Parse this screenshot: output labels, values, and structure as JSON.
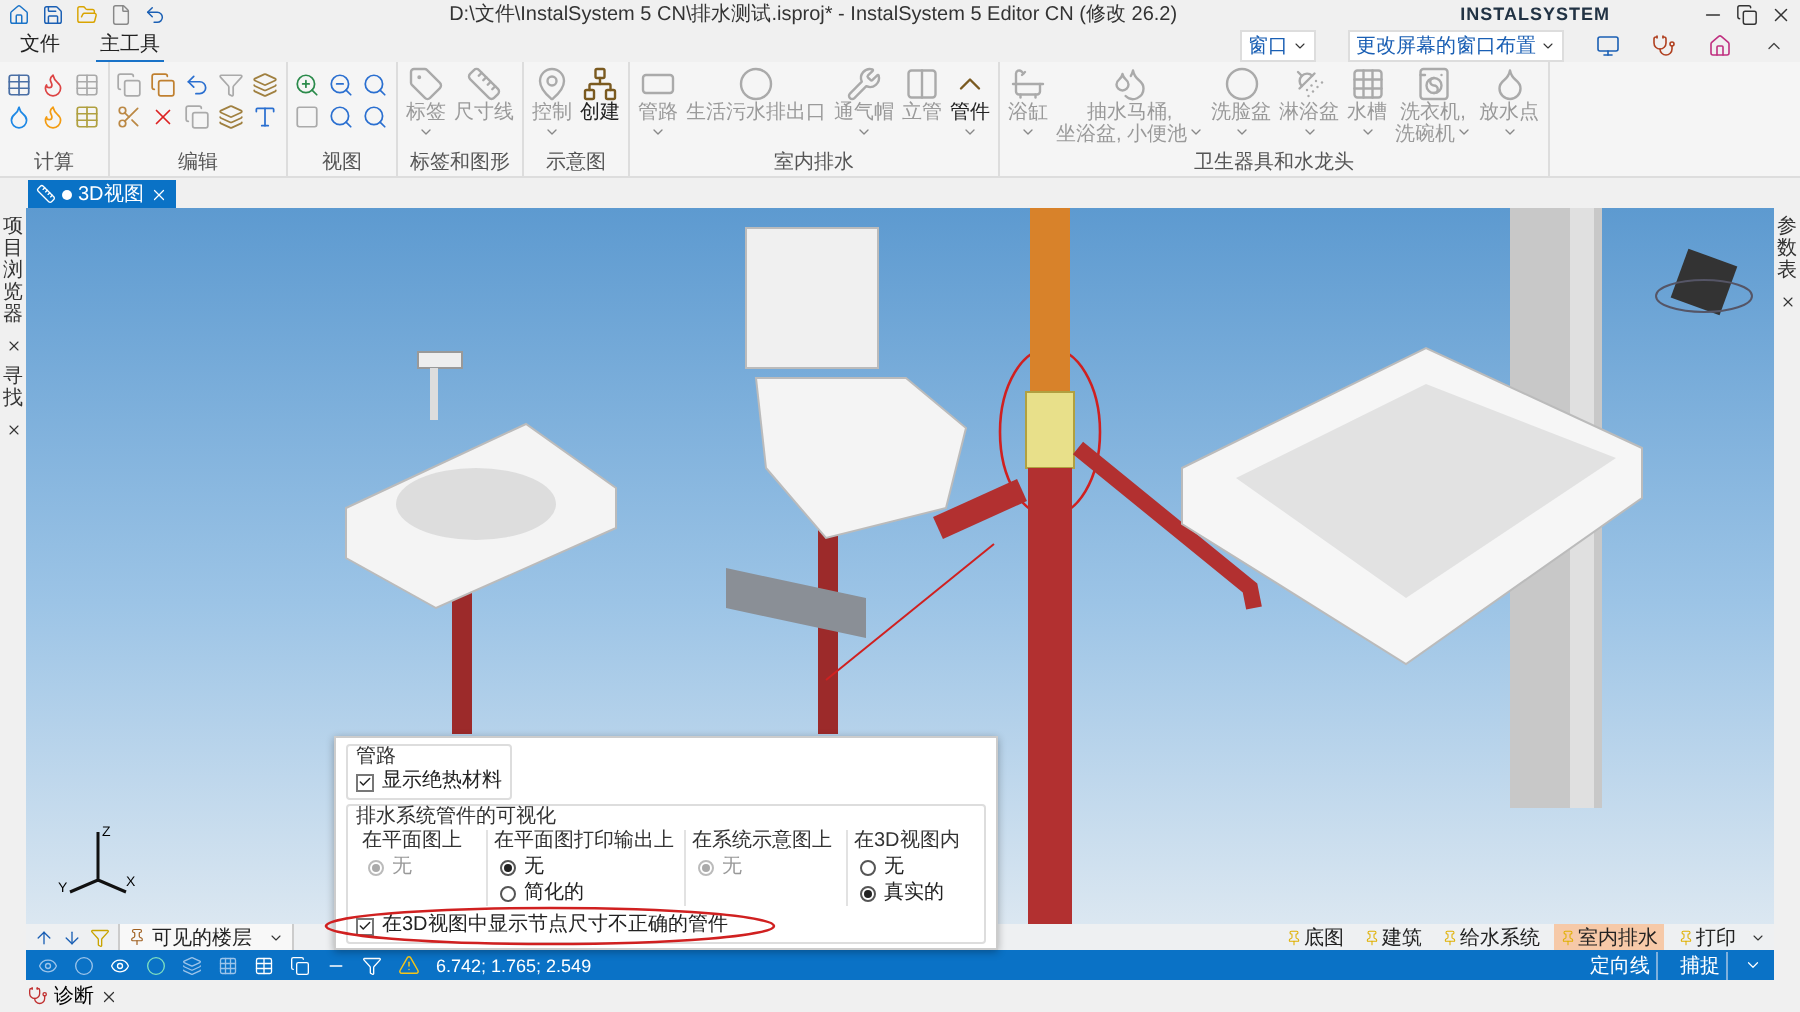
{
  "title_bar": {
    "title": "D:\\文件\\InstalSystem 5 CN\\排水测试.isproj* - InstalSystem 5 Editor CN (修改 26.2)",
    "logo": "INSTALSYSTEM"
  },
  "menu_tabs": [
    {
      "label": "文件",
      "selected": false
    },
    {
      "label": "主工具",
      "selected": true
    }
  ],
  "window_menus": [
    {
      "label": "窗口"
    },
    {
      "label": "更改屏幕的窗口布置"
    }
  ],
  "ribbon_groups": [
    {
      "label": "计算"
    },
    {
      "label": "编辑"
    },
    {
      "label": "视图"
    },
    {
      "label": "标签和图形",
      "buttons": [
        {
          "lines": [
            "标签"
          ],
          "disabled": true,
          "dropdown": true
        },
        {
          "lines": [
            "尺寸线"
          ],
          "disabled": true,
          "dropdown": false
        }
      ]
    },
    {
      "label": "示意图",
      "buttons": [
        {
          "lines": [
            "控制"
          ],
          "disabled": true,
          "dropdown": true
        },
        {
          "lines": [
            "创建"
          ],
          "disabled": false,
          "dropdown": false
        }
      ]
    },
    {
      "label": "室内排水",
      "buttons": [
        {
          "lines": [
            "管路"
          ],
          "disabled": true,
          "dropdown": true
        },
        {
          "lines": [
            "生活污水排出口"
          ],
          "disabled": true,
          "dropdown": false
        },
        {
          "lines": [
            "通气帽"
          ],
          "disabled": true,
          "dropdown": true
        },
        {
          "lines": [
            "立管"
          ],
          "disabled": true,
          "dropdown": false
        },
        {
          "lines": [
            "管件"
          ],
          "disabled": false,
          "dropdown": true
        }
      ]
    },
    {
      "label": "卫生器具和水龙头",
      "buttons": [
        {
          "lines": [
            "浴缸"
          ],
          "disabled": true,
          "dropdown": true
        },
        {
          "lines": [
            "抽水马桶,",
            "坐浴盆, 小便池"
          ],
          "disabled": true,
          "dropdown": true
        },
        {
          "lines": [
            "洗脸盆"
          ],
          "disabled": true,
          "dropdown": true
        },
        {
          "lines": [
            "淋浴盆"
          ],
          "disabled": true,
          "dropdown": true
        },
        {
          "lines": [
            "水槽"
          ],
          "disabled": true,
          "dropdown": true
        },
        {
          "lines": [
            "洗衣机,",
            "洗碗机"
          ],
          "disabled": true,
          "dropdown": true
        },
        {
          "lines": [
            "放水点"
          ],
          "disabled": true,
          "dropdown": true
        }
      ]
    }
  ],
  "document_tab": {
    "label": "3D视图",
    "modified": true,
    "selected": true
  },
  "left_panels": [
    {
      "label": "项目浏览器"
    },
    {
      "label": "寻找"
    }
  ],
  "right_panels": [
    {
      "label": "参数表"
    }
  ],
  "axis_labels": [
    "Z",
    "Y",
    "X"
  ],
  "floor_select": {
    "value": "可见的楼层"
  },
  "layer_tags": [
    {
      "label": "底图",
      "selected": false
    },
    {
      "label": "建筑",
      "selected": false
    },
    {
      "label": "给水系统",
      "selected": false
    },
    {
      "label": "室内排水",
      "selected": true
    },
    {
      "label": "打印",
      "selected": false
    }
  ],
  "popup": {
    "pipes_group": {
      "title": "管路",
      "checkbox": {
        "label": "显示绝热材料",
        "checked": true
      }
    },
    "fittings_group": {
      "title": "排水系统管件的可视化",
      "columns": [
        {
          "heading": "在平面图上",
          "options": [
            {
              "label": "无",
              "selected": true,
              "disabled": true
            }
          ]
        },
        {
          "heading": "在平面图打印输出上",
          "options": [
            {
              "label": "无",
              "selected": true,
              "disabled": false
            },
            {
              "label": "简化的",
              "selected": false,
              "disabled": false
            }
          ]
        },
        {
          "heading": "在系统示意图上",
          "options": [
            {
              "label": "无",
              "selected": true,
              "disabled": true
            }
          ]
        },
        {
          "heading": "在3D视图内",
          "options": [
            {
              "label": "无",
              "selected": false,
              "disabled": false
            },
            {
              "label": "真实的",
              "selected": true,
              "disabled": false
            }
          ]
        }
      ]
    },
    "checkbox": {
      "label": "在3D视图中显示节点尺寸不正确的管件",
      "checked": true
    }
  },
  "status_bar": {
    "coordinates": "6.742; 1.765; 2.549",
    "modes": [
      {
        "label": "定向线",
        "on": true
      },
      {
        "label": "捕捉",
        "on": true
      }
    ]
  },
  "bottom_panels": [
    {
      "label": "诊断"
    }
  ]
}
